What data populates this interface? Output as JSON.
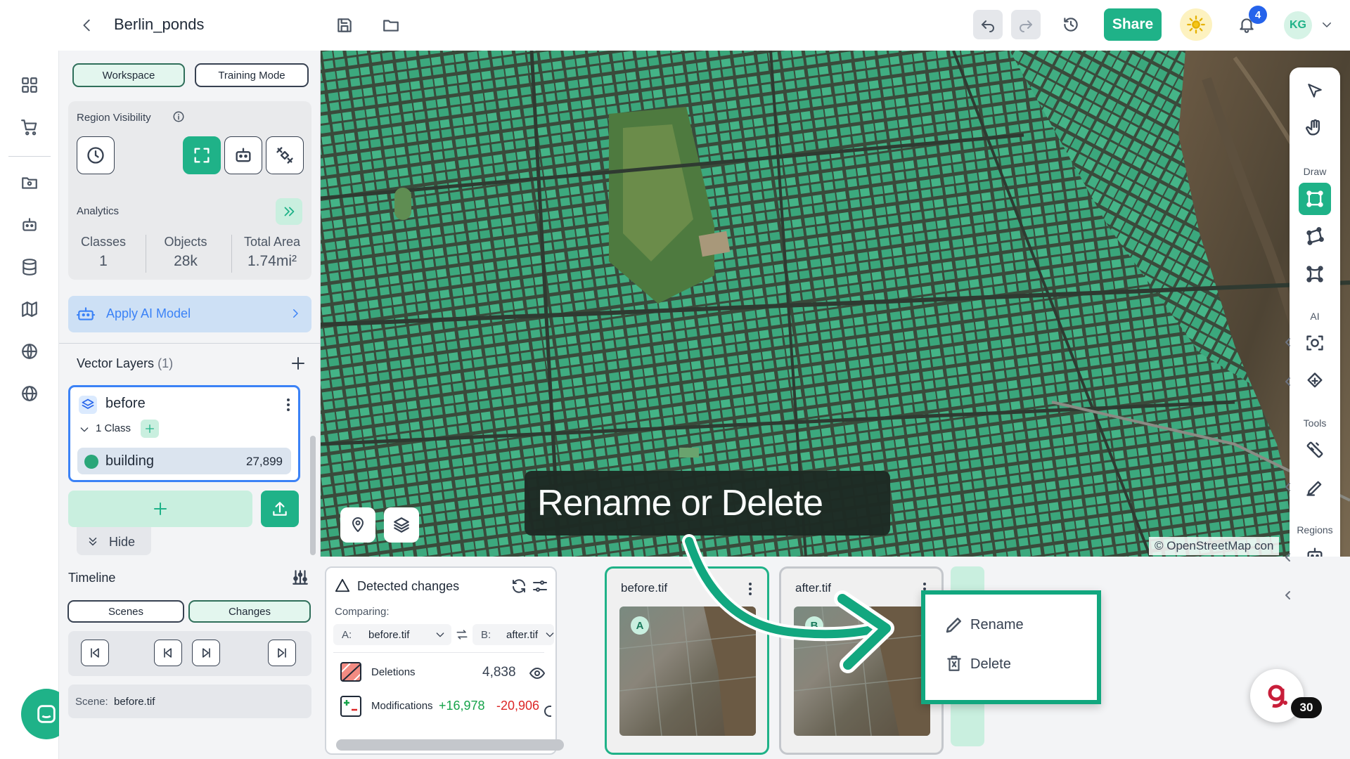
{
  "header": {
    "project_title": "Berlin_ponds",
    "share_label": "Share",
    "notification_count": "4",
    "user_initials": "KG"
  },
  "workspace": {
    "tab_workspace": "Workspace",
    "tab_training": "Training Mode",
    "region_visibility_label": "Region Visibility"
  },
  "analytics": {
    "title": "Analytics",
    "stats": [
      {
        "label": "Classes",
        "value": "1"
      },
      {
        "label": "Objects",
        "value": "28k"
      },
      {
        "label": "Total Area",
        "value": "1.74mi²"
      }
    ],
    "apply_ai_label": "Apply AI Model"
  },
  "vector_layers": {
    "title": "Vector Layers",
    "count": "(1)",
    "layer_name": "before",
    "class_count_label": "1 Class",
    "class_name": "building",
    "class_count": "27,899",
    "hide_label": "Hide"
  },
  "map": {
    "overlay_text": "Rename or Delete",
    "attribution": "© OpenStreetMap con"
  },
  "right_toolbar": {
    "draw_label": "Draw",
    "ai_label": "AI",
    "tools_label": "Tools",
    "regions_label": "Regions"
  },
  "timeline": {
    "title": "Timeline",
    "tab_scenes": "Scenes",
    "tab_changes": "Changes",
    "scene_prefix": "Scene:",
    "scene_value": "before.tif"
  },
  "detected_changes": {
    "title": "Detected changes",
    "comparing_label": "Comparing:",
    "a_prefix": "A:",
    "a_value": "before.tif",
    "b_prefix": "B:",
    "b_value": "after.tif",
    "deletions_label": "Deletions",
    "deletions_value": "4,838",
    "modifications_label": "Modifications",
    "mod_plus": "+16,978",
    "mod_minus": "-20,906"
  },
  "scenes": {
    "before_name": "before.tif",
    "before_badge": "A",
    "after_name": "after.tif",
    "after_badge": "B"
  },
  "context_menu": {
    "rename_label": "Rename",
    "delete_label": "Delete"
  },
  "support": {
    "badge_count": "30"
  },
  "colors": {
    "brand_green": "#1fb288",
    "overlay_bg": "#1e2a24",
    "highlight_green": "#12a77f"
  }
}
